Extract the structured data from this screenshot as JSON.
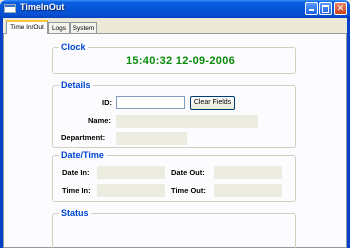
{
  "window": {
    "title": "TimeInOut",
    "minimize_glyph": "",
    "maximize_glyph": "",
    "close_glyph": "✕"
  },
  "tabs": [
    {
      "label": "Time In/Out",
      "active": true
    },
    {
      "label": "Logs",
      "active": false
    },
    {
      "label": "System",
      "active": false
    }
  ],
  "clock": {
    "title": "Clock",
    "value": "15:40:32 12-09-2006"
  },
  "details": {
    "title": "Details",
    "id_label": "ID:",
    "id_value": "",
    "clear_button": "Clear Fields",
    "name_label": "Name:",
    "name_value": "",
    "department_label": "Department:",
    "department_value": ""
  },
  "datetime": {
    "title": "Date/Time",
    "date_in_label": "Date In:",
    "date_in_value": "",
    "date_out_label": "Date Out:",
    "date_out_value": "",
    "time_in_label": "Time In:",
    "time_in_value": "",
    "time_out_label": "Time Out:",
    "time_out_value": ""
  },
  "status": {
    "title": "Status"
  },
  "colors": {
    "group_title": "#0046d5",
    "clock_text": "#0a8a0a",
    "titlebar": "#0554d6"
  }
}
